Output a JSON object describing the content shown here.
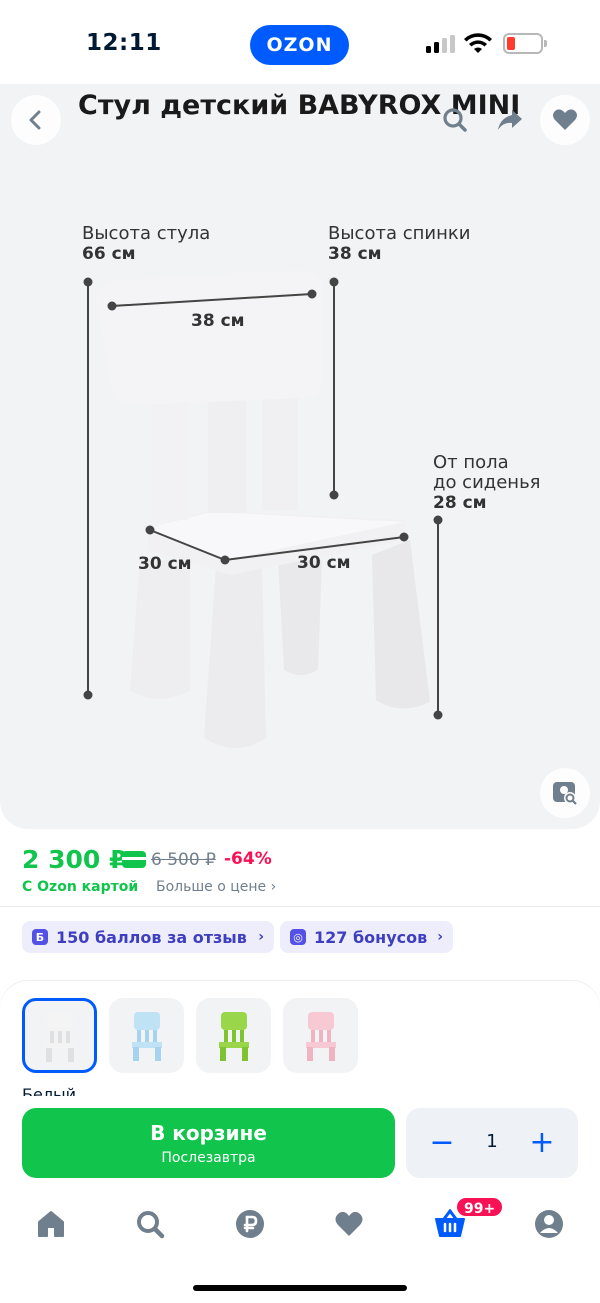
{
  "status_bar": {
    "time": "12:11",
    "logo": "OZON"
  },
  "product": {
    "title": "Стул детский BABYROX MINI"
  },
  "gallery": {
    "dims": {
      "chair_height_label": "Высота стула",
      "chair_height_value": "66 см",
      "back_height_label": "Высота спинки",
      "back_height_value": "38 см",
      "seat_from_floor_label_1": "От пола",
      "seat_from_floor_label_2": "до сиденья",
      "seat_from_floor_value": "28 см",
      "back_width": "38 см",
      "seat_depth": "30 см",
      "seat_width": "30 см"
    }
  },
  "price": {
    "current": "2 300 ₽",
    "old": "6 500 ₽",
    "discount": "-64%",
    "card_note": "С Ozon картой",
    "more_link": "Больше о цене"
  },
  "chips": {
    "review_points": "150 баллов за отзыв",
    "review_icon": "Б",
    "bonuses": "127 бонусов",
    "bonus_icon": "◎"
  },
  "variants": {
    "items": [
      {
        "name": "white",
        "color": "#f4f4f4",
        "accent": "#e0e0e0"
      },
      {
        "name": "blue",
        "color": "#bfe2f5",
        "accent": "#a6d3ee"
      },
      {
        "name": "green",
        "color": "#9ad64a",
        "accent": "#7fc232"
      },
      {
        "name": "pink",
        "color": "#f7c9d4",
        "accent": "#efb3c2"
      }
    ],
    "selected_label": "Белый"
  },
  "buy": {
    "cart_title": "В корзине",
    "cart_sub": "Послезавтра",
    "quantity": "1",
    "minus": "−",
    "plus": "+"
  },
  "nav": {
    "cart_badge": "99+",
    "items": [
      "home-icon",
      "search-icon",
      "ruble-icon",
      "heart-icon",
      "basket-icon",
      "profile-icon"
    ]
  },
  "colors": {
    "brand_blue": "#005bff",
    "price_green": "#10c44c",
    "discount_pink": "#f91155"
  }
}
